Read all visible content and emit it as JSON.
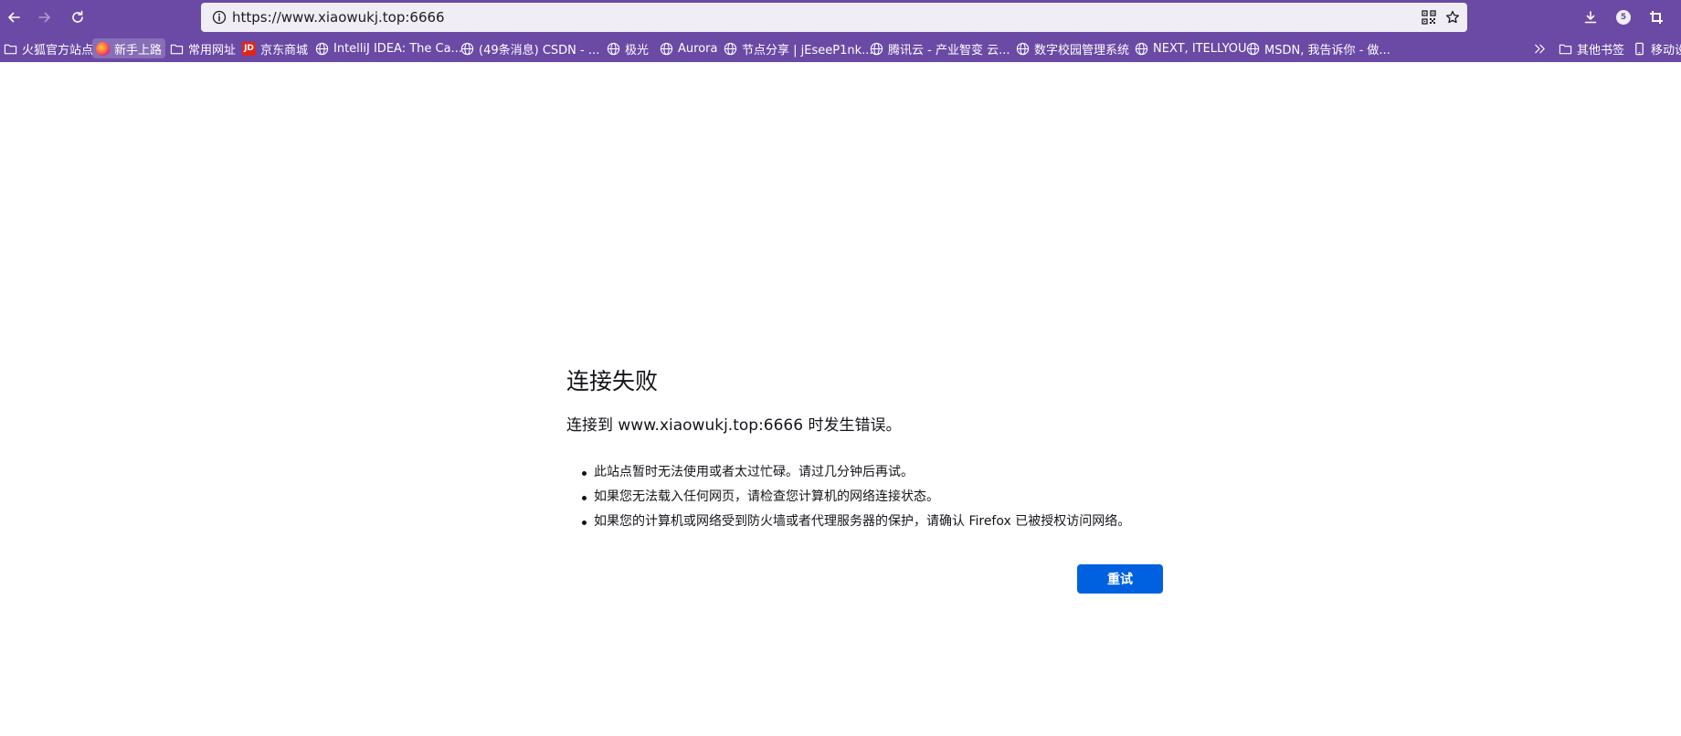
{
  "browser": {
    "url": "https://www.xiaowukj.top:6666",
    "badge_count": "5"
  },
  "bookmarks": {
    "items": [
      {
        "label": "火狐官方站点",
        "icon": "folder-icon"
      },
      {
        "label": "新手上路",
        "icon": "firefox-icon"
      },
      {
        "label": "常用网址",
        "icon": "folder-icon"
      },
      {
        "label": "京东商城",
        "icon": "jd-icon",
        "icon_text": "JD"
      },
      {
        "label": "IntelliJ IDEA: The Ca...",
        "icon": "globe-icon"
      },
      {
        "label": "(49条消息) CSDN - ...",
        "icon": "globe-icon"
      },
      {
        "label": "极光",
        "icon": "globe-icon"
      },
      {
        "label": "Aurora",
        "icon": "globe-icon"
      },
      {
        "label": "节点分享 | jEseeP1nk...",
        "icon": "globe-icon"
      },
      {
        "label": "腾讯云 - 产业智变 云...",
        "icon": "globe-icon"
      },
      {
        "label": "数字校园管理系统",
        "icon": "globe-icon"
      },
      {
        "label": "NEXT, ITELLYOU",
        "icon": "globe-icon"
      },
      {
        "label": "MSDN, 我告诉你 - 做...",
        "icon": "globe-icon"
      }
    ],
    "overflow_icon": "chevron-double-right-icon",
    "other_bookmarks": "其他书签",
    "mobile_bookmarks": "移动设"
  },
  "error": {
    "title": "连接失败",
    "description": "连接到 www.xiaowukj.top:6666 时发生错误。",
    "tips": [
      "此站点暂时无法使用或者太过忙碌。请过几分钟后再试。",
      "如果您无法载入任何网页，请检查您计算机的网络连接状态。",
      "如果您的计算机或网络受到防火墙或者代理服务器的保护，请确认 Firefox 已被授权访问网络。"
    ],
    "retry_label": "重试"
  },
  "colors": {
    "toolbar": "#6a4aa5",
    "urlbar": "#f0edf5",
    "primary_button": "#0061e0"
  }
}
